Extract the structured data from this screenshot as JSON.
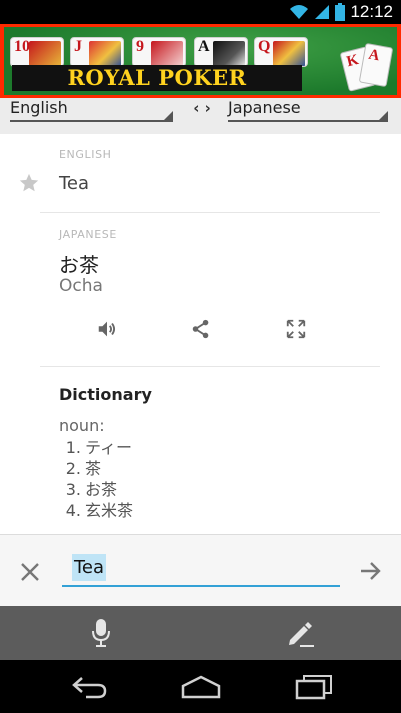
{
  "status_bar": {
    "time": "12:12"
  },
  "ad": {
    "title": "ROYAL POKER",
    "card_ranks": [
      "10",
      "J",
      "9",
      "A",
      "Q"
    ],
    "fan_ranks": [
      "K",
      "A"
    ]
  },
  "languages": {
    "source": "English",
    "target": "Japanese",
    "swap_symbol": "‹ ›"
  },
  "source": {
    "label": "ENGLISH",
    "text": "Tea"
  },
  "translation": {
    "label": "JAPANESE",
    "text": "お茶",
    "romanization": "Ocha"
  },
  "dictionary": {
    "title": "Dictionary",
    "part_of_speech": "noun:",
    "entries": [
      {
        "num": "1.",
        "text": "ティー"
      },
      {
        "num": "2.",
        "text": "茶"
      },
      {
        "num": "3.",
        "text": "お茶"
      },
      {
        "num": "4.",
        "text": "玄米茶"
      }
    ]
  },
  "input": {
    "value": "Tea"
  },
  "colors": {
    "accent": "#33a1d6",
    "ad_border": "#ff2a00",
    "ad_title": "#ffd21f",
    "toolbar": "#5c5c5c"
  },
  "icons": [
    "wifi-icon",
    "signal-icon",
    "battery-icon",
    "star-icon",
    "speaker-icon",
    "share-icon",
    "fullscreen-icon",
    "clear-icon",
    "arrow-right-icon",
    "microphone-icon",
    "pen-icon",
    "back-icon",
    "home-icon",
    "recents-icon"
  ]
}
